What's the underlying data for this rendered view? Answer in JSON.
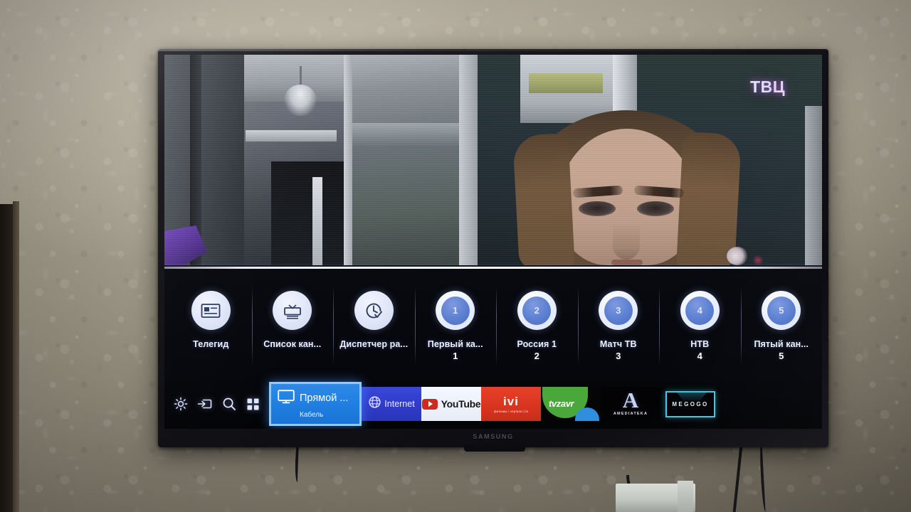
{
  "scene": {
    "device_brand": "SAMSUNG",
    "room": "wall-mounted-tv-on-damask-wallpaper"
  },
  "broadcast": {
    "channel_bug": {
      "part1": "ТВ",
      "part2": "Ц",
      "full": "ТВЦ"
    }
  },
  "menu": {
    "tiles": [
      {
        "label": "Телегид",
        "icon": "guide-icon",
        "type": "function"
      },
      {
        "label": "Список кан...",
        "icon": "channel-list-icon",
        "type": "function"
      },
      {
        "label": "Диспетчер ра...",
        "icon": "schedule-clock-icon",
        "type": "function"
      },
      {
        "label": "Первый ка...",
        "number": "1",
        "badge": "1",
        "type": "channel"
      },
      {
        "label": "Россия 1",
        "number": "2",
        "badge": "2",
        "type": "channel"
      },
      {
        "label": "Матч ТВ",
        "number": "3",
        "badge": "3",
        "type": "channel"
      },
      {
        "label": "НТВ",
        "number": "4",
        "badge": "4",
        "type": "channel"
      },
      {
        "label": "Пятый кан...",
        "number": "5",
        "badge": "5",
        "type": "channel"
      }
    ]
  },
  "appbar": {
    "system_icons": [
      {
        "name": "settings-gear-icon"
      },
      {
        "name": "source-input-icon"
      },
      {
        "name": "search-icon"
      },
      {
        "name": "apps-grid-icon"
      }
    ],
    "live_tile": {
      "title": "Прямой ...",
      "subtitle": "Кабель",
      "icon": "tv-monitor-icon",
      "selected": true,
      "accent": "#1f7ee0",
      "border": "#8fc7ff"
    },
    "apps": [
      {
        "name": "Internet",
        "icon": "globe-icon",
        "bg": "#2f3cc9"
      },
      {
        "name": "YouTube",
        "icon": "youtube-icon",
        "bg": "#eef2fb"
      },
      {
        "name": "ivi",
        "tagline": "фильмы і серіали | ів",
        "bg": "#d7341f"
      },
      {
        "name": "tvzavr",
        "bg": "#4aa83a"
      },
      {
        "name": "AMEDIATEKA",
        "mark": "A",
        "bg": "#030305"
      },
      {
        "name": "MEGOGO",
        "bg": "#030305"
      }
    ]
  }
}
